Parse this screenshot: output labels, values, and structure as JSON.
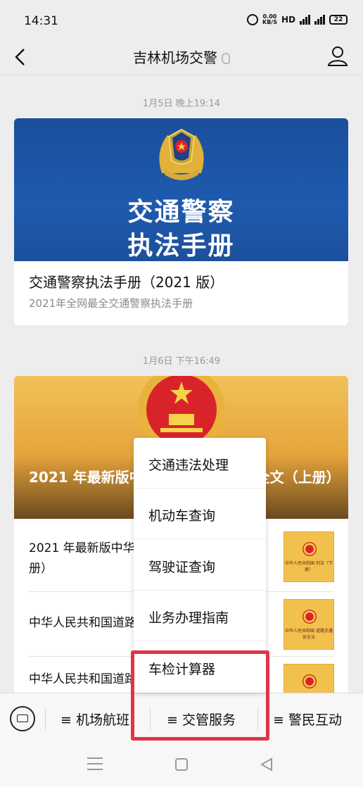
{
  "status_bar": {
    "time": "14:31",
    "net_speed_value": "0.00",
    "net_speed_unit": "KB/S",
    "hd": "HD",
    "battery": "22"
  },
  "header": {
    "title": "吉林机场交警"
  },
  "feed": [
    {
      "timestamp": "1月5日 晚上19:14",
      "cover_line1": "交通警察",
      "cover_line2": "执法手册",
      "title": "交通警察执法手册（2021 版）",
      "desc": "2021年全网最全交通警察执法手册"
    },
    {
      "timestamp": "1月6日 下午16:49",
      "cover_title": "2021 年最新版中华人民共和国刑法全文（上册）",
      "items": [
        {
          "title": "2021 年最新版中华人民共和国刑法全文（下册）",
          "thumb_caption": "中华人民共和国 刑法（下册）"
        },
        {
          "title": "中华人民共和国道路交通安全法",
          "thumb_caption": "中华人民共和国 道路交通安全法"
        },
        {
          "title": "中华人民共和国道路交通安全法实施条例",
          "thumb_caption": ""
        }
      ]
    }
  ],
  "popup_menu": {
    "items": [
      "交通违法处理",
      "机动车查询",
      "驾驶证查询",
      "业务办理指南",
      "车检计算器"
    ]
  },
  "tab_bar": {
    "tabs": [
      "≡ 机场航班",
      "≡ 交管服务",
      "≡ 警民互动"
    ]
  },
  "colors": {
    "highlight": "#e33347",
    "background": "#ededed"
  }
}
